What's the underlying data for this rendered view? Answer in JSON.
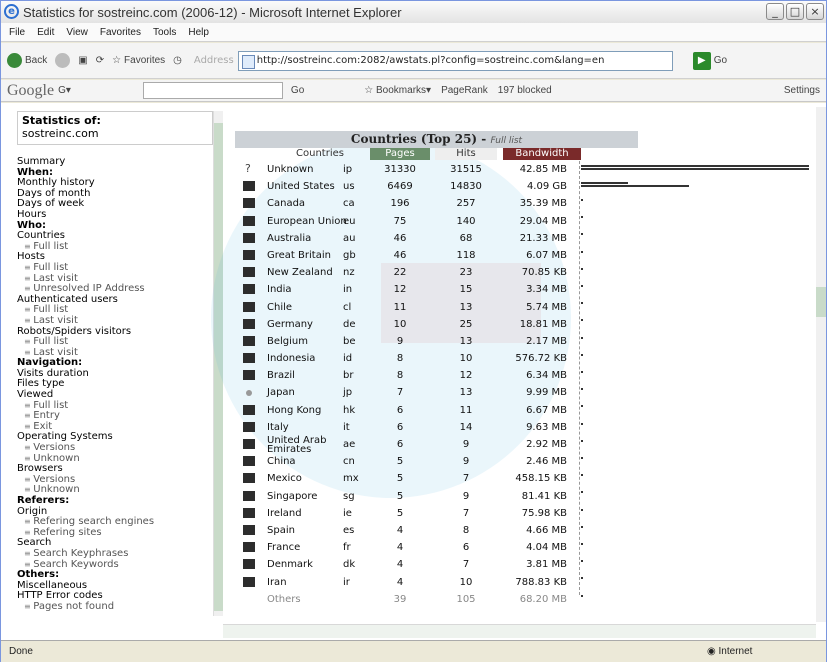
{
  "window": {
    "title": "Statistics for sostreinc.com (2006-12) - Microsoft Internet Explorer"
  },
  "menu": [
    "File",
    "Edit",
    "View",
    "Favorites",
    "Tools",
    "Help"
  ],
  "toolbar": {
    "back": "Back",
    "favorites": "Favorites",
    "address_label": "Address",
    "url": "http://sostreinc.com:2082/awstats.pl?config=sostreinc.com&lang=en",
    "go": "Go"
  },
  "google_bar": {
    "logo": "Google",
    "go": "Go",
    "bookmarks": "Bookmarks",
    "pagerank": "PageRank",
    "blocked": "197 blocked",
    "settings": "Settings"
  },
  "sidebar": {
    "stats_of": "Statistics of:",
    "site": "sostreinc.com",
    "items": [
      {
        "t": "Summary",
        "k": "n"
      },
      {
        "t": "When:",
        "k": "h"
      },
      {
        "t": "Monthly history",
        "k": "n"
      },
      {
        "t": "Days of month",
        "k": "n"
      },
      {
        "t": "Days of week",
        "k": "n"
      },
      {
        "t": "Hours",
        "k": "n"
      },
      {
        "t": "Who:",
        "k": "h"
      },
      {
        "t": "Countries",
        "k": "n"
      },
      {
        "t": "Full list",
        "k": "s"
      },
      {
        "t": "Hosts",
        "k": "n"
      },
      {
        "t": "Full list",
        "k": "s"
      },
      {
        "t": "Last visit",
        "k": "s"
      },
      {
        "t": "Unresolved IP Address",
        "k": "s"
      },
      {
        "t": "Authenticated users",
        "k": "n"
      },
      {
        "t": "Full list",
        "k": "s"
      },
      {
        "t": "Last visit",
        "k": "s"
      },
      {
        "t": "Robots/Spiders visitors",
        "k": "n"
      },
      {
        "t": "Full list",
        "k": "s"
      },
      {
        "t": "Last visit",
        "k": "s"
      },
      {
        "t": "Navigation:",
        "k": "h"
      },
      {
        "t": "Visits duration",
        "k": "n"
      },
      {
        "t": "Files type",
        "k": "n"
      },
      {
        "t": "Viewed",
        "k": "n"
      },
      {
        "t": "Full list",
        "k": "s"
      },
      {
        "t": "Entry",
        "k": "s"
      },
      {
        "t": "Exit",
        "k": "s"
      },
      {
        "t": "Operating Systems",
        "k": "n"
      },
      {
        "t": "Versions",
        "k": "s"
      },
      {
        "t": "Unknown",
        "k": "s"
      },
      {
        "t": "Browsers",
        "k": "n"
      },
      {
        "t": "Versions",
        "k": "s"
      },
      {
        "t": "Unknown",
        "k": "s"
      },
      {
        "t": "Referers:",
        "k": "h"
      },
      {
        "t": "Origin",
        "k": "n"
      },
      {
        "t": "Refering search engines",
        "k": "s"
      },
      {
        "t": "Refering sites",
        "k": "s"
      },
      {
        "t": "Search",
        "k": "n"
      },
      {
        "t": "Search Keyphrases",
        "k": "s"
      },
      {
        "t": "Search Keywords",
        "k": "s"
      },
      {
        "t": "Others:",
        "k": "h"
      },
      {
        "t": "Miscellaneous",
        "k": "n"
      },
      {
        "t": "HTTP Error codes",
        "k": "n"
      },
      {
        "t": "Pages not found",
        "k": "s"
      }
    ]
  },
  "table": {
    "title": "Countries (Top 25)",
    "separator": "-",
    "full_list": "Full list",
    "headers": {
      "countries": "Countries",
      "pages": "Pages",
      "hits": "Hits",
      "bandwidth": "Bandwidth"
    },
    "rows": [
      {
        "country": "Unknown",
        "code": "ip",
        "pages": "31330",
        "hits": "31515",
        "bw": "42.85 MB"
      },
      {
        "country": "United States",
        "code": "us",
        "pages": "6469",
        "hits": "14830",
        "bw": "4.09 GB"
      },
      {
        "country": "Canada",
        "code": "ca",
        "pages": "196",
        "hits": "257",
        "bw": "35.39 MB"
      },
      {
        "country": "European Union",
        "code": "eu",
        "pages": "75",
        "hits": "140",
        "bw": "29.04 MB"
      },
      {
        "country": "Australia",
        "code": "au",
        "pages": "46",
        "hits": "68",
        "bw": "21.33 MB"
      },
      {
        "country": "Great Britain",
        "code": "gb",
        "pages": "46",
        "hits": "118",
        "bw": "6.07 MB"
      },
      {
        "country": "New Zealand",
        "code": "nz",
        "pages": "22",
        "hits": "23",
        "bw": "70.85 KB"
      },
      {
        "country": "India",
        "code": "in",
        "pages": "12",
        "hits": "15",
        "bw": "3.34 MB"
      },
      {
        "country": "Chile",
        "code": "cl",
        "pages": "11",
        "hits": "13",
        "bw": "5.74 MB"
      },
      {
        "country": "Germany",
        "code": "de",
        "pages": "10",
        "hits": "25",
        "bw": "18.81 MB"
      },
      {
        "country": "Belgium",
        "code": "be",
        "pages": "9",
        "hits": "13",
        "bw": "2.17 MB"
      },
      {
        "country": "Indonesia",
        "code": "id",
        "pages": "8",
        "hits": "10",
        "bw": "576.72 KB"
      },
      {
        "country": "Brazil",
        "code": "br",
        "pages": "8",
        "hits": "12",
        "bw": "6.34 MB"
      },
      {
        "country": "Japan",
        "code": "jp",
        "pages": "7",
        "hits": "13",
        "bw": "9.99 MB"
      },
      {
        "country": "Hong Kong",
        "code": "hk",
        "pages": "6",
        "hits": "11",
        "bw": "6.67 MB"
      },
      {
        "country": "Italy",
        "code": "it",
        "pages": "6",
        "hits": "14",
        "bw": "9.63 MB"
      },
      {
        "country": "United Arab Emirates",
        "code": "ae",
        "pages": "6",
        "hits": "9",
        "bw": "2.92 MB"
      },
      {
        "country": "China",
        "code": "cn",
        "pages": "5",
        "hits": "9",
        "bw": "2.46 MB"
      },
      {
        "country": "Mexico",
        "code": "mx",
        "pages": "5",
        "hits": "7",
        "bw": "458.15 KB"
      },
      {
        "country": "Singapore",
        "code": "sg",
        "pages": "5",
        "hits": "9",
        "bw": "81.41 KB"
      },
      {
        "country": "Ireland",
        "code": "ie",
        "pages": "5",
        "hits": "7",
        "bw": "75.98 KB"
      },
      {
        "country": "Spain",
        "code": "es",
        "pages": "4",
        "hits": "8",
        "bw": "4.66 MB"
      },
      {
        "country": "France",
        "code": "fr",
        "pages": "4",
        "hits": "6",
        "bw": "4.04 MB"
      },
      {
        "country": "Denmark",
        "code": "dk",
        "pages": "4",
        "hits": "7",
        "bw": "3.81 MB"
      },
      {
        "country": "Iran",
        "code": "ir",
        "pages": "4",
        "hits": "10",
        "bw": "788.83 KB"
      },
      {
        "country": "Others",
        "code": "",
        "pages": "39",
        "hits": "105",
        "bw": "68.20 MB"
      }
    ]
  },
  "status": {
    "left": "Done",
    "zone": "Internet"
  }
}
